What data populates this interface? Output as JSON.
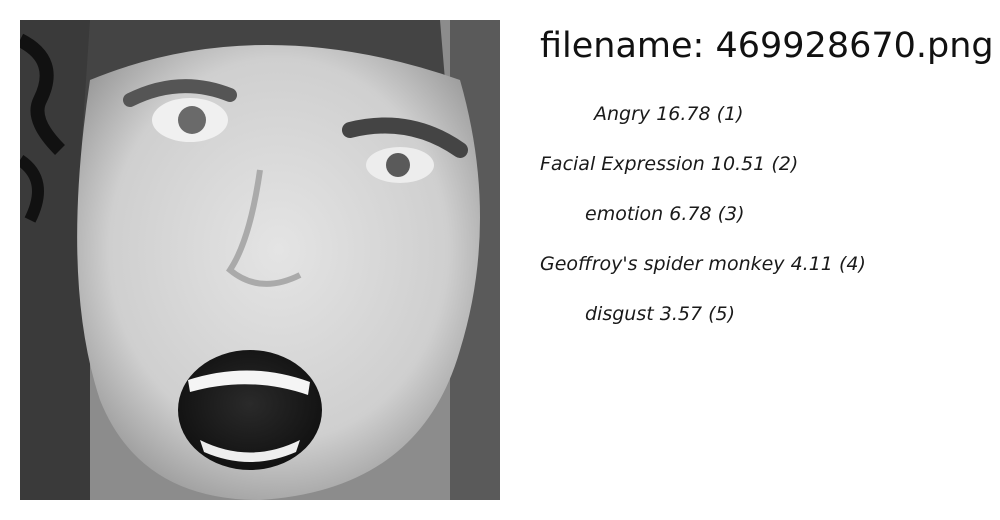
{
  "filename_label": "filename: 469928670.png",
  "predictions": [
    {
      "label": "Angry",
      "score": "16.78",
      "rank": "(1)"
    },
    {
      "label": "Facial Expression",
      "score": "10.51",
      "rank": "(2)"
    },
    {
      "label": "emotion",
      "score": " 6.78",
      "rank": "(3)"
    },
    {
      "label": "Geoffroy's spider monkey",
      "score": " 4.11",
      "rank": "(4)"
    },
    {
      "label": "disgust",
      "score": " 3.57",
      "rank": "(5)"
    }
  ]
}
